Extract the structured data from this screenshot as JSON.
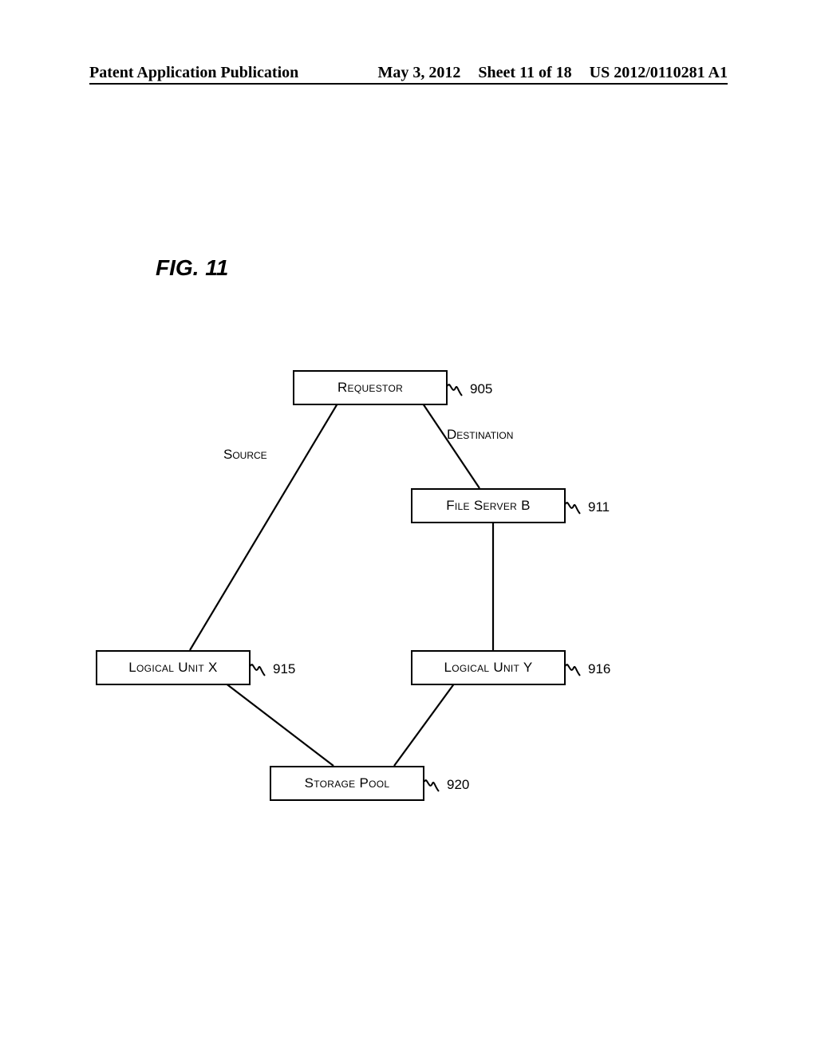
{
  "header": {
    "pubtype": "Patent Application Publication",
    "date": "May 3, 2012",
    "sheet": "Sheet 11 of 18",
    "docnum": "US 2012/0110281 A1"
  },
  "figure": {
    "title": "FIG. 11"
  },
  "edges": {
    "source": "Source",
    "destination": "Destination"
  },
  "boxes": {
    "requestor": "Requestor",
    "file_server_b": "File Server B",
    "logical_unit_x": "Logical Unit X",
    "logical_unit_y": "Logical Unit Y",
    "storage_pool": "Storage Pool"
  },
  "refs": {
    "requestor": "905",
    "file_server_b": "911",
    "logical_unit_x": "915",
    "logical_unit_y": "916",
    "storage_pool": "920"
  }
}
